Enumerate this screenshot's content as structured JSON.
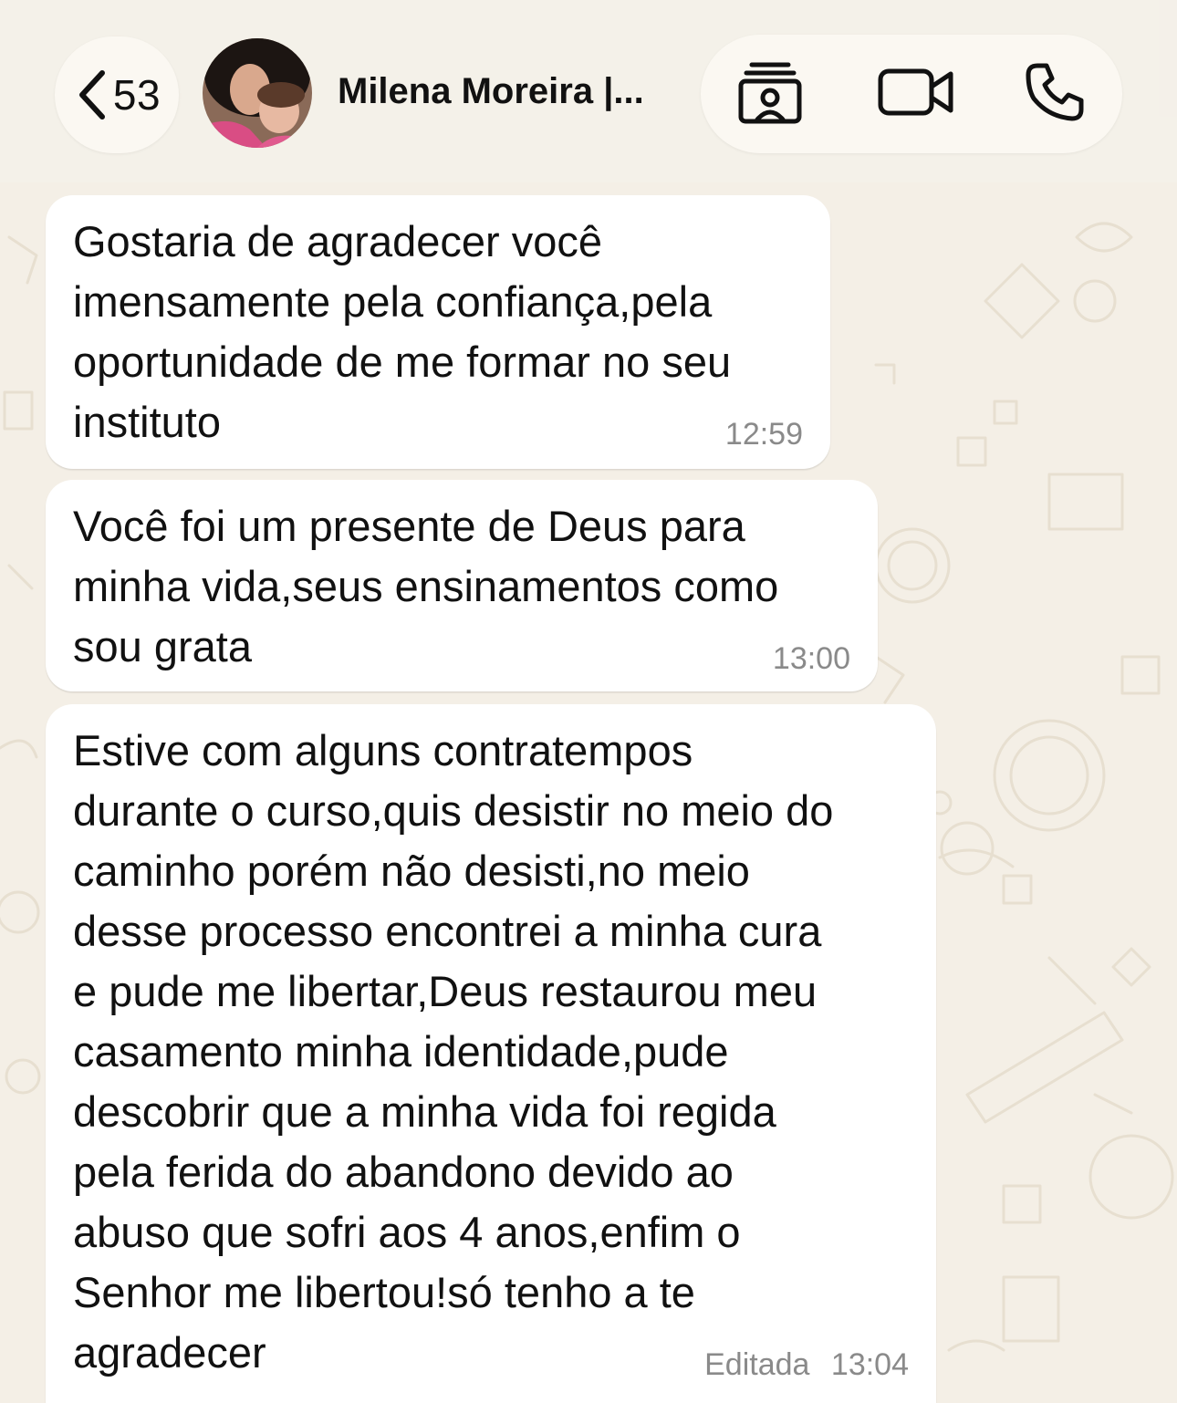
{
  "header": {
    "back_count": "53",
    "contact_name": "Milena Moreira |..."
  },
  "icons": {
    "back": "chevron-left-icon",
    "contact_card": "contact-card-icon",
    "video": "video-camera-icon",
    "phone": "phone-icon"
  },
  "messages": [
    {
      "text": "Gostaria de agradecer você\nimensamente pela confiança,pela\noportunidade de me formar no seu\ninstituto",
      "time": "12:59",
      "edited_label": ""
    },
    {
      "text": "Você foi um presente de Deus para\nminha vida,seus ensinamentos como\nsou grata",
      "time": "13:00",
      "edited_label": ""
    },
    {
      "text": "Estive com alguns contratempos\ndurante o curso,quis desistir no meio do\ncaminho porém não desisti,no meio\ndesse processo encontrei a minha cura\ne pude me libertar,Deus restaurou meu\ncasamento minha identidade,pude\ndescobrir que a minha vida foi regida\npela ferida do abandono devido ao\nabuso que sofri aos 4 anos,enfim o\nSenhor me libertou!só tenho a te\nagradecer",
      "time": "13:04",
      "edited_label": "Editada"
    }
  ],
  "colors": {
    "wallpaper": "#f4efe6",
    "bubble": "#ffffff",
    "meta_text": "#8a8a8a"
  }
}
